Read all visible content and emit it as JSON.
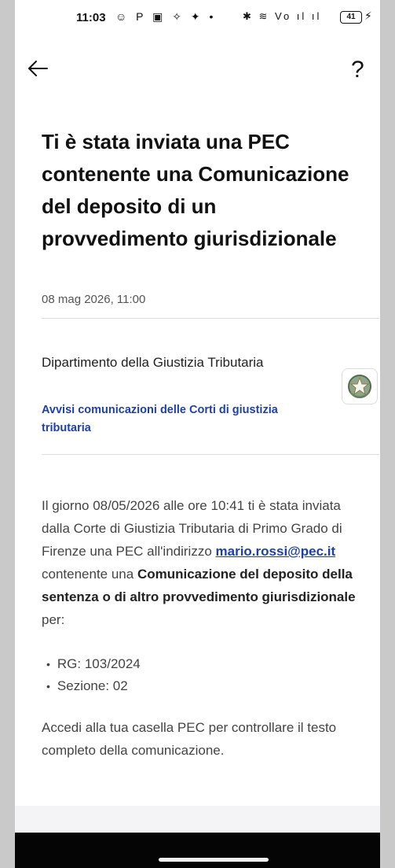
{
  "status_bar": {
    "time": "11:03",
    "left_icons": "☺ P ▣ ✧ ✦ •",
    "right_icons": "✱ ≋ Vo ıl ıl",
    "battery": "41"
  },
  "header": {
    "help_label": "?"
  },
  "message": {
    "title": "Ti è stata inviata una PEC contenente una Comunicazione del deposito di un provvedimento giurisdizionale",
    "date": "08 mag 2026, 11:00",
    "sender_name": "Dipartimento della Giustizia Tributaria",
    "sender_service": "Avvisi comunicazioni delle Corti di giustizia tributaria",
    "body_part1": "Il giorno 08/05/2026 alle ore 10:41 ti è stata inviata dalla Corte di Giustizia Tributaria di Primo Grado di Firenze una PEC all'indirizzo ",
    "pec_address": "mario.rossi@pec.it",
    "body_part2": " contenente una ",
    "body_bold": "Comunicazione del deposito della sentenza o di altro provvedimento giurisdizionale",
    "body_part3": " per:",
    "bullets": [
      "RG: 103/2024",
      "Sezione: 02"
    ],
    "footer": "Accedi alla tua casella PEC per controllare il testo completo della comunicazione."
  },
  "colors": {
    "accent": "#1f3fae",
    "text": "#111111",
    "nav_bar": "#050505"
  }
}
